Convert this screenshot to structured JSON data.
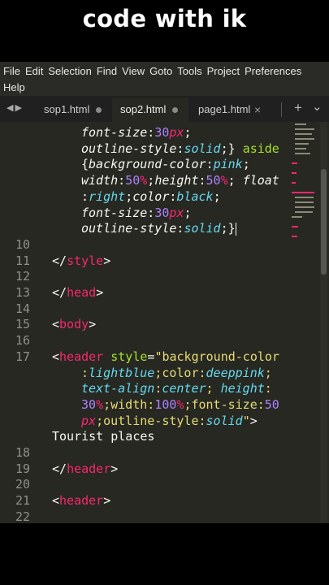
{
  "banner": {
    "title": "code with ik"
  },
  "menu": {
    "items": [
      "File",
      "Edit",
      "Selection",
      "Find",
      "View",
      "Goto",
      "Tools",
      "Project",
      "Preferences"
    ],
    "help": "Help"
  },
  "tabs": [
    {
      "label": "sop1.html",
      "active": false,
      "indicator": "dot"
    },
    {
      "label": "sop2.html",
      "active": true,
      "indicator": "dot"
    },
    {
      "label": "page1.html",
      "active": false,
      "indicator": "close"
    }
  ],
  "toolbar": {
    "back_icon": "◀",
    "forward_icon": "▶",
    "new_tab_icon": "+",
    "tab_list_icon": "⌄"
  },
  "colors": {
    "editor_bg": "#272822",
    "tag": "#f92672",
    "attr": "#a6e22e",
    "string": "#e6db74",
    "number": "#ae81ff",
    "value": "#66d9ef"
  },
  "code_lines": [
    {
      "n": "",
      "indent": true,
      "t": [
        [
          "prop",
          "font-size"
        ],
        [
          "punc",
          ":"
        ],
        [
          "num",
          "30"
        ],
        [
          "unit",
          "px"
        ],
        [
          "punc",
          ";"
        ]
      ]
    },
    {
      "n": "",
      "indent": true,
      "t": [
        [
          "prop",
          "outline-style"
        ],
        [
          "punc",
          ":"
        ],
        [
          "val",
          "solid"
        ],
        [
          "punc",
          ";} "
        ],
        [
          "attr",
          "aside"
        ]
      ]
    },
    {
      "n": "",
      "indent": true,
      "t": [
        [
          "punc",
          "{"
        ],
        [
          "prop",
          "background-color"
        ],
        [
          "punc",
          ":"
        ],
        [
          "val",
          "pink"
        ],
        [
          "punc",
          ";"
        ]
      ]
    },
    {
      "n": "",
      "indent": true,
      "t": [
        [
          "prop",
          "width"
        ],
        [
          "punc",
          ":"
        ],
        [
          "num",
          "50"
        ],
        [
          "unit",
          "%"
        ],
        [
          "punc",
          ";"
        ],
        [
          "prop",
          "height"
        ],
        [
          "punc",
          ":"
        ],
        [
          "num",
          "50"
        ],
        [
          "unit",
          "%"
        ],
        [
          "punc",
          "; "
        ],
        [
          "prop",
          "float"
        ]
      ]
    },
    {
      "n": "",
      "indent": true,
      "t": [
        [
          "punc",
          ":"
        ],
        [
          "val",
          "right"
        ],
        [
          "punc",
          ";"
        ],
        [
          "prop",
          "color"
        ],
        [
          "punc",
          ":"
        ],
        [
          "val",
          "black"
        ],
        [
          "punc",
          ";"
        ]
      ]
    },
    {
      "n": "",
      "indent": true,
      "t": [
        [
          "prop",
          "font-size"
        ],
        [
          "punc",
          ":"
        ],
        [
          "num",
          "30"
        ],
        [
          "unit",
          "px"
        ],
        [
          "punc",
          ";"
        ]
      ]
    },
    {
      "n": "",
      "indent": true,
      "cursor": true,
      "t": [
        [
          "prop",
          "outline-style"
        ],
        [
          "punc",
          ":"
        ],
        [
          "val",
          "solid"
        ],
        [
          "punc",
          ";}"
        ]
      ]
    },
    {
      "n": "10",
      "t": []
    },
    {
      "n": "11",
      "t": [
        [
          "punc",
          "</"
        ],
        [
          "tag",
          "style"
        ],
        [
          "punc",
          ">"
        ]
      ]
    },
    {
      "n": "12",
      "t": []
    },
    {
      "n": "13",
      "t": [
        [
          "punc",
          "</"
        ],
        [
          "tag",
          "head"
        ],
        [
          "punc",
          ">"
        ]
      ]
    },
    {
      "n": "14",
      "t": []
    },
    {
      "n": "15",
      "t": [
        [
          "punc",
          "<"
        ],
        [
          "tag",
          "body"
        ],
        [
          "punc",
          ">"
        ]
      ]
    },
    {
      "n": "16",
      "t": []
    },
    {
      "n": "17",
      "t": [
        [
          "punc",
          "<"
        ],
        [
          "tag",
          "header"
        ],
        [
          "punc",
          " "
        ],
        [
          "attr",
          "style"
        ],
        [
          "punc",
          "="
        ],
        [
          "str",
          "\"background-color"
        ]
      ]
    },
    {
      "n": "",
      "indent": true,
      "t": [
        [
          "str",
          ":"
        ],
        [
          "val",
          "lightblue"
        ],
        [
          "str",
          ";color:"
        ],
        [
          "val",
          "deeppink"
        ],
        [
          "str",
          ";"
        ]
      ]
    },
    {
      "n": "",
      "indent": true,
      "t": [
        [
          "val",
          "text-align"
        ],
        [
          "str",
          ":"
        ],
        [
          "val",
          "center"
        ],
        [
          "str",
          "; "
        ],
        [
          "val",
          "height"
        ],
        [
          "str",
          ":"
        ]
      ]
    },
    {
      "n": "",
      "indent": true,
      "t": [
        [
          "num",
          "30"
        ],
        [
          "unit",
          "%"
        ],
        [
          "str",
          ";width:"
        ],
        [
          "num",
          "100"
        ],
        [
          "unit",
          "%"
        ],
        [
          "str",
          ";font-size:"
        ],
        [
          "num",
          "50"
        ]
      ]
    },
    {
      "n": "",
      "indent": true,
      "t": [
        [
          "unit",
          "px"
        ],
        [
          "str",
          ";outline-style:"
        ],
        [
          "val",
          "solid"
        ],
        [
          "str",
          "\""
        ],
        [
          "punc",
          ">"
        ]
      ]
    },
    {
      "n": "",
      "t": [
        [
          "punc",
          "Tourist places"
        ]
      ]
    },
    {
      "n": "18",
      "t": []
    },
    {
      "n": "19",
      "t": [
        [
          "punc",
          "</"
        ],
        [
          "tag",
          "header"
        ],
        [
          "punc",
          ">"
        ]
      ]
    },
    {
      "n": "20",
      "t": []
    },
    {
      "n": "21",
      "t": [
        [
          "punc",
          "<"
        ],
        [
          "tag",
          "header"
        ],
        [
          "punc",
          ">"
        ]
      ]
    },
    {
      "n": "22",
      "t": []
    }
  ]
}
